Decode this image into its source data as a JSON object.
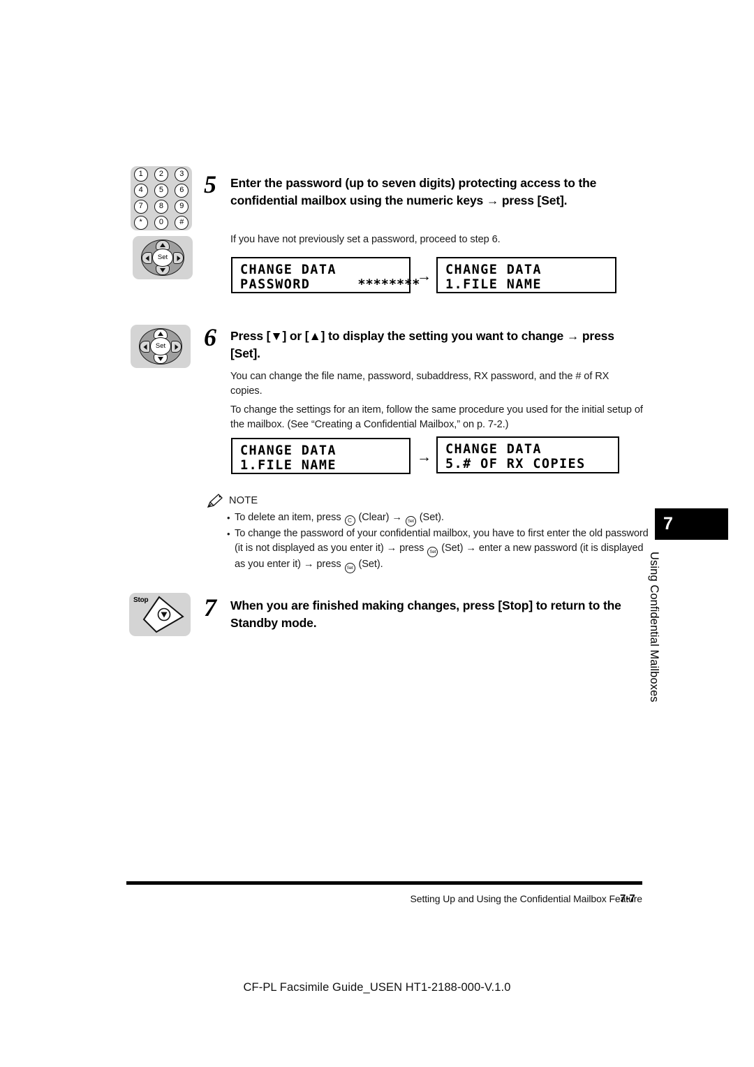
{
  "page": {
    "chapter_tab": {
      "number": "7",
      "label": "Using Confidential Mailboxes"
    },
    "footer": {
      "title": "Setting Up and Using the Confidential Mailbox Feature",
      "page_number": "7-7",
      "doc_code": "CF-PL Facsimile Guide_USEN HT1-2188-000-V.1.0"
    }
  },
  "keypad": {
    "icon_name": "numeric-keypad-icon",
    "keys": [
      "1",
      "2",
      "3",
      "4",
      "5",
      "6",
      "7",
      "8",
      "9",
      "*",
      "0",
      "#"
    ]
  },
  "setpad": {
    "center_label": "Set"
  },
  "stopkey": {
    "label": "Stop"
  },
  "steps": [
    {
      "number": "5",
      "heading": "Enter the password (up to seven digits) protecting access to the confidential mailbox using the numeric keys → press [Set].",
      "body": "If you have not previously set a password, proceed to step 6."
    },
    {
      "number": "6",
      "heading": "Press [▼] or [▲] to display the setting you want to change → press [Set].",
      "body1": "You can change the file name, password, subaddress, RX password, and the # of RX copies.",
      "body2": "To change the settings for an item, follow the same procedure you used for the initial setup of the mailbox. (See “Creating a Confidential Mailbox,” on p. 7-2.)"
    },
    {
      "number": "7",
      "heading": "When you are finished making changes, press [Stop] to return to the Standby mode."
    }
  ],
  "lcd_displays": {
    "row1": {
      "left": {
        "line1": "CHANGE DATA",
        "line2": "PASSWORD",
        "line2_right": "********"
      },
      "arrow": "→",
      "right": {
        "line1": "CHANGE DATA",
        "line2": " 1.FILE NAME"
      }
    },
    "row2": {
      "left": {
        "line1": "CHANGE DATA",
        "line2": " 1.FILE NAME"
      },
      "arrow": "→",
      "right": {
        "line1": "CHANGE DATA",
        "line2": " 5.# OF RX COPIES"
      }
    }
  },
  "note": {
    "title": "NOTE",
    "bullet": "•",
    "items": [
      {
        "part1": "To delete an item, press",
        "key1": "C",
        "part2": "(Clear)",
        "arrow1": "→",
        "key2": "Set",
        "part3": "(Set)."
      },
      {
        "part1": "To change the password of your confidential mailbox, you have to first enter the old",
        "part2": "password (it is not displayed as you enter it)",
        "arrow1": "→",
        "press1": "press",
        "key1": "Set",
        "part3": "(Set)",
        "arrow2": "→",
        "part4": "enter a new",
        "part5": "password (it is displayed as you enter it)",
        "arrow3": "→",
        "press2": "press",
        "key2": "Set",
        "part6": "(Set)."
      }
    ]
  }
}
